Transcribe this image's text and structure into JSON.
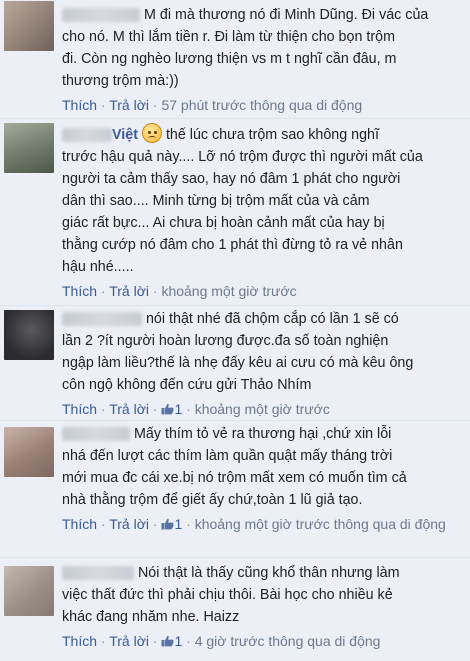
{
  "comments": [
    {
      "name": "",
      "lines": [
        "M đi mà thương nó đi Minh Dũng. Đi vác của",
        "cho nó. M thì lắm tiền r. Đi làm từ thiện cho bọn trộm",
        "đi. Còn ng nghèo lương thiện vs m t nghĩ      cần đâu, m",
        "thương trộm mà:))"
      ],
      "like": "Thích",
      "reply": "Trả lời",
      "meta": "57 phút trước thông qua di động"
    },
    {
      "name": "Việt",
      "lines": [
        "thế lúc chưa trộm sao không nghĩ",
        "trước hậu quả này.... Lỡ nó trộm được thì người mất của",
        "người ta cảm thấy sao, hay nó đâm 1 phát cho người",
        "dân thì sao.... Minh từng bị trộm mất của và cảm",
        "giác rất bực... Ai chưa bị hoàn cảnh mất của hay bị",
        "thằng cướp nó đâm cho 1 phát thì đừng tỏ ra vẻ nhân",
        "hậu nhé....."
      ],
      "like": "Thích",
      "reply": "Trả lời",
      "meta": "khoảng một giờ trước"
    },
    {
      "name": "",
      "lines": [
        "nói thật nhé đã chộm cắp có lần 1 sẽ có",
        "lần 2 ?ít người hoàn lương được.đa số toàn nghiện",
        "ngập làm liều?thế là nhẹ đấy kêu ai cưu có mà kêu ông",
        "côn ngộ không đến cứu gửi Thảo Nhím"
      ],
      "like": "Thích",
      "reply": "Trả lời",
      "likes": "1",
      "meta": "khoảng một giờ trước"
    },
    {
      "name": "",
      "lines": [
        "Mấy thím tỏ vẻ ra thương hại ,chứ xin lỗi",
        "nhá đến lượt các thím làm quần quật mấy tháng trời",
        "mới mua đc cái xe.bị nó trộm mất xem có muốn tìm cả",
        "nhà thằng trộm để giết ấy chứ,toàn 1 lũ giả tạo."
      ],
      "like": "Thích",
      "reply": "Trả lời",
      "likes": "1",
      "meta": "khoảng một giờ trước thông qua di động"
    },
    {
      "name": "",
      "lines": [
        "Nói thật là thấy cũng khổ thân nhưng làm",
        "việc thất đức thì phải chịu thôi. Bài học cho nhiều kẻ",
        "khác đang nhăm nhe. Haizz"
      ],
      "like": "Thích",
      "reply": "Trả lời",
      "likes": "1",
      "meta": "4 giờ trước thông qua di động"
    }
  ]
}
